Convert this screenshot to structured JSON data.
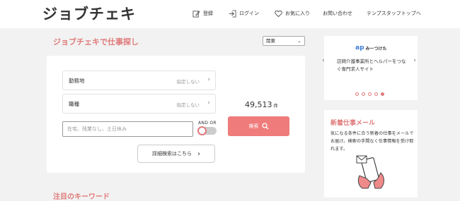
{
  "header": {
    "logo": "ジョブチェキ",
    "nav": {
      "register": "登録",
      "login": "ログイン",
      "favorites": "お気に入り",
      "contact": "お問い合わせ",
      "temps_top": "テンプスタッフトップへ"
    }
  },
  "search": {
    "title": "ジョブチェキで仕事探し",
    "region": "関東",
    "location_label": "勤務地",
    "location_value": "指定しない",
    "job_label": "職種",
    "job_value": "指定しない",
    "keyword_placeholder": "在宅、残業なし、土日休み",
    "andor_label": "AND OR",
    "count": "49,513",
    "count_unit": "件",
    "search_button": "検索",
    "detail_button": "詳細検索はこちら"
  },
  "banner": {
    "logo_text": "みーつけた",
    "text": "訪問介護事業所とヘルパーをつなぐ専門求人サイト",
    "dots_total": 5,
    "active_dot": 5
  },
  "mail": {
    "title": "新着仕事メール",
    "text": "気になる条件に合う新着の仕事をメールでお届け。検索の手間なく仕事情報を受け取れます。"
  },
  "keywords": {
    "title": "注目のキーワード"
  },
  "colors": {
    "accent": "#e07a7a",
    "button": "#ef7b7b"
  }
}
